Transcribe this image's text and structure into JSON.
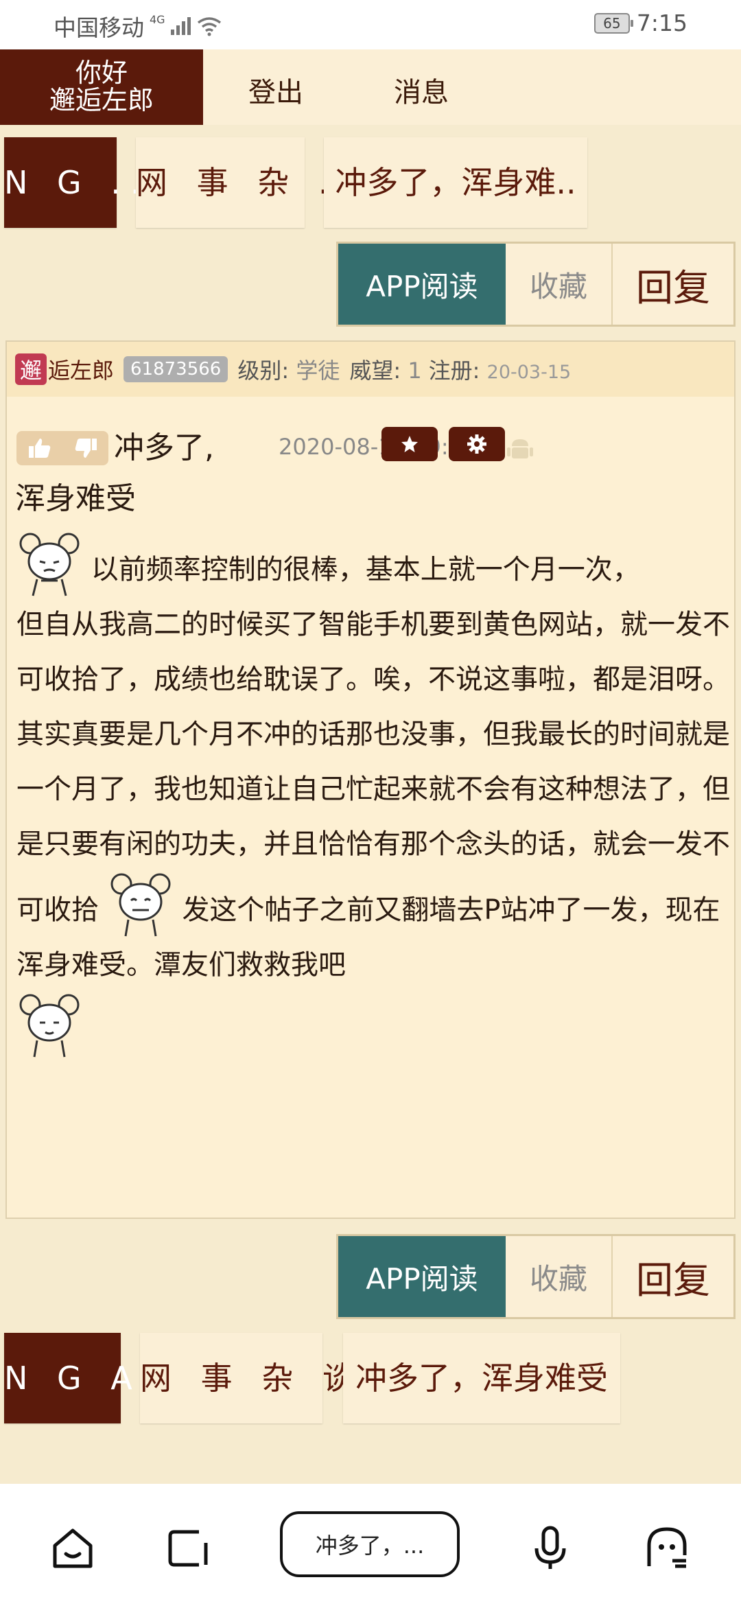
{
  "status_bar": {
    "carrier": "中国移动",
    "network": "4G",
    "battery": "65",
    "time": "7:15"
  },
  "top_nav": {
    "greeting_line1": "你好",
    "greeting_line2": "邂逅左郎",
    "logout": "登出",
    "messages": "消息"
  },
  "breadcrumb_top": [
    "N G ..",
    "网 事 杂 ..",
    "冲多了，浑身难.."
  ],
  "breadcrumb_bottom": [
    "N G A",
    "网 事 杂 谈",
    "冲多了，浑身难受"
  ],
  "actions": {
    "app_read": "APP阅读",
    "favorite": "收藏",
    "reply": "回复"
  },
  "post": {
    "avatar_char": "邂",
    "username": "逅左郎",
    "uid": "61873566",
    "level_label": "级别:",
    "level_value": "学徒",
    "prestige_label": "威望:",
    "prestige_value": "1",
    "register_label": "注册:",
    "register_date": "20-03-15",
    "title_line1": "冲多了,",
    "title_line2": "浑身难受",
    "date": "2020-08-17 19:05",
    "body_p1a": "以前频率控制的很棒，基本上就一个月一次，",
    "body_p1b": "但自从我高二的时候买了智能手机要到黄色网站，就一发不可收拾了，成绩也给耽误了。唉，不说这事啦，都是泪呀。",
    "body_p2a": "其实真要是几个月不冲的话那也没事，但我最长的时间就是一个月了，我也知道让自己忙起来就不会有这种想法了，但是只要有闲的功夫，并且恰恰有那个念头的话，就会一发不可收拾",
    "body_p2b": "发这个帖子之前又翻墙去P站冲了一发，现在浑身难受。潭友们救救我吧"
  },
  "browser": {
    "url_text": "冲多了，..."
  },
  "colors": {
    "brown": "#5b1a0b",
    "teal": "#346e6e",
    "cream": "#fbefd6"
  }
}
